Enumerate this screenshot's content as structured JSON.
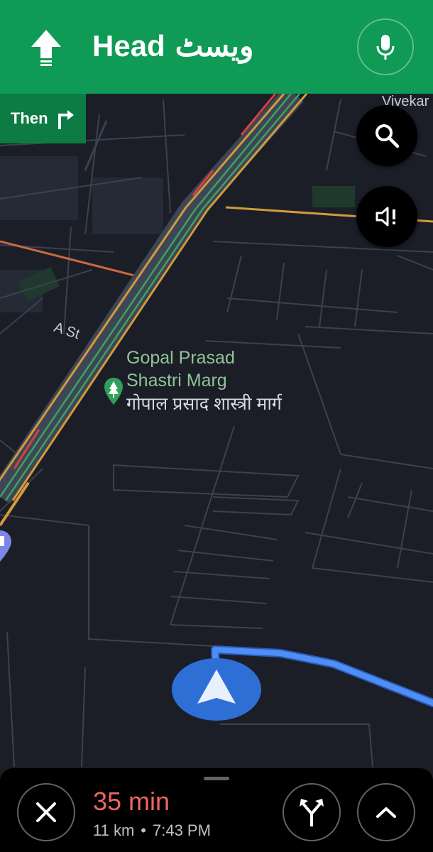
{
  "header": {
    "title_en": "Head",
    "title_ur": "ویسٹ",
    "maneuver_icon": "straight-arrow-icon",
    "mic_icon": "mic-icon",
    "color": "#0f9a55"
  },
  "then_chip": {
    "label": "Then",
    "icon": "turn-right-icon",
    "color": "#0d7c44"
  },
  "map": {
    "labels": {
      "vivek": "Vivekar",
      "a_st": "A St",
      "poi_en": "Gopal Prasad Shastri Marg",
      "poi_hi": "गोपाल प्रसाद शास्त्री मार्ग"
    },
    "route_color": "#4f8df7",
    "puck_color": "#2e6fd6"
  },
  "controls": {
    "search_icon": "search-icon",
    "sound_icon": "sound-alert-icon"
  },
  "eta": {
    "duration": "35 min",
    "distance": "11 km",
    "separator": "•",
    "arrival": "7:43 PM",
    "duration_color": "#ee675c"
  },
  "bottom_controls": {
    "close_icon": "close-icon",
    "alt_routes_icon": "alternate-routes-icon",
    "expand_icon": "chevron-up-icon"
  }
}
